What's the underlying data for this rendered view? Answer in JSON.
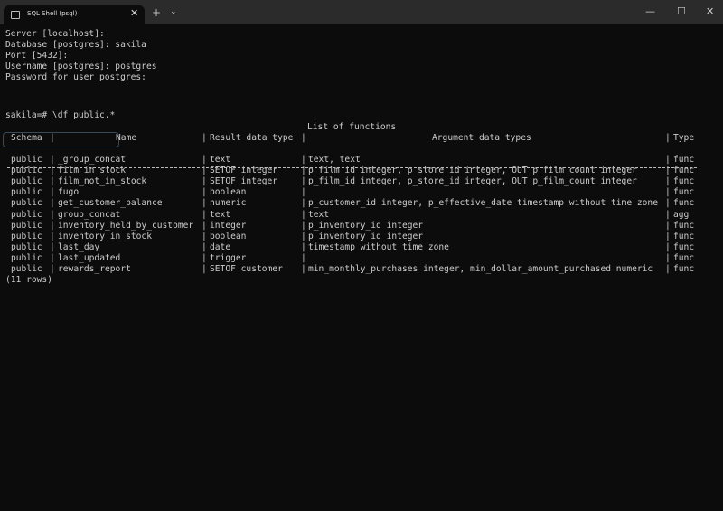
{
  "window": {
    "tab_title": "SQL Shell (psql)",
    "tab_icon": "terminal-icon",
    "new_tab": "+",
    "dropdown": "⌄",
    "minimize": "—",
    "maximize": "☐",
    "close": "✕",
    "tab_close": "✕"
  },
  "session": {
    "lines": [
      "Server [localhost]:",
      "Database [postgres]: sakila",
      "Port [5432]:",
      "Username [postgres]: postgres",
      "Password for user postgres:"
    ],
    "prompt": "sakila=# \\df public.*"
  },
  "table": {
    "title": "List of functions",
    "headers": [
      "Schema",
      "Name",
      "Result data type",
      "Argument data types",
      "Type"
    ],
    "rows": [
      [
        "public",
        "_group_concat",
        "text",
        "text, text",
        "func"
      ],
      [
        "public",
        "film_in_stock",
        "SETOF integer",
        "p_film_id integer, p_store_id integer, OUT p_film_count integer",
        "func"
      ],
      [
        "public",
        "film_not_in_stock",
        "SETOF integer",
        "p_film_id integer, p_store_id integer, OUT p_film_count integer",
        "func"
      ],
      [
        "public",
        "fugo",
        "boolean",
        "",
        "func"
      ],
      [
        "public",
        "get_customer_balance",
        "numeric",
        "p_customer_id integer, p_effective_date timestamp without time zone",
        "func"
      ],
      [
        "public",
        "group_concat",
        "text",
        "text",
        "agg"
      ],
      [
        "public",
        "inventory_held_by_customer",
        "integer",
        "p_inventory_id integer",
        "func"
      ],
      [
        "public",
        "inventory_in_stock",
        "boolean",
        "p_inventory_id integer",
        "func"
      ],
      [
        "public",
        "last_day",
        "date",
        "timestamp without time zone",
        "func"
      ],
      [
        "public",
        "last_updated",
        "trigger",
        "",
        "func"
      ],
      [
        "public",
        "rewards_report",
        "SETOF customer",
        "min_monthly_purchases integer, min_dollar_amount_purchased numeric",
        "func"
      ]
    ],
    "footer": "(11 rows)"
  }
}
